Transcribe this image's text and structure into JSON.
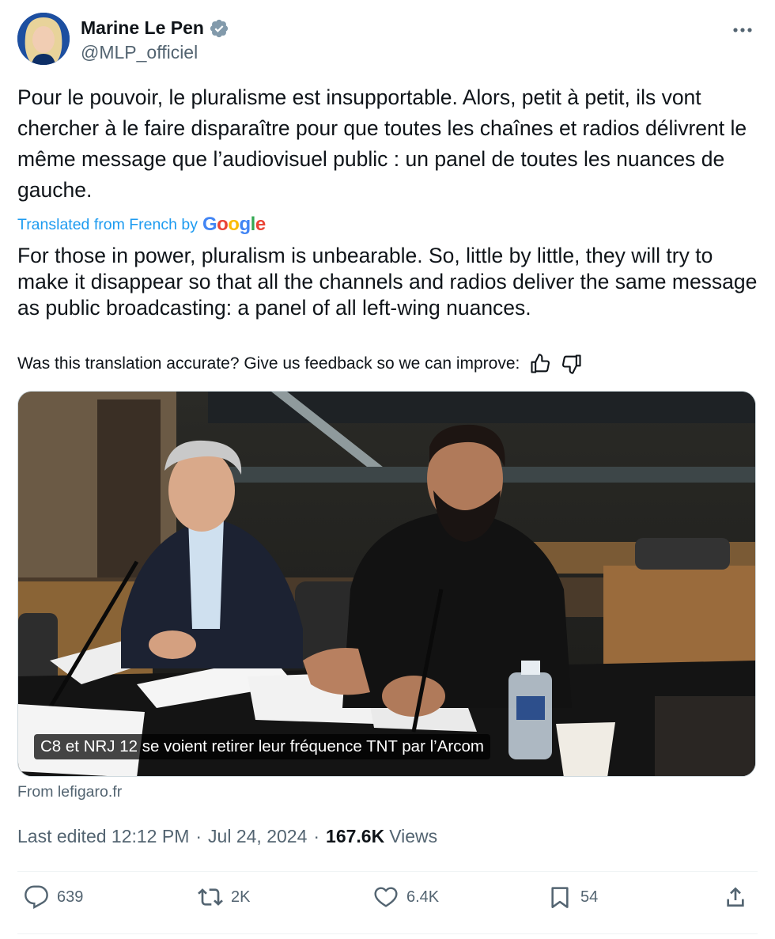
{
  "author": {
    "name": "Marine Le Pen",
    "handle": "@MLP_officiel",
    "verified": true,
    "avatar_icon": "avatar"
  },
  "tweet": {
    "text": "Pour le pouvoir, le pluralisme est insupportable. Alors, petit à petit, ils vont chercher à le faire disparaître pour que toutes les chaînes et radios délivrent le même message que l’audiovisuel public : un panel de toutes les nuances de gauche.",
    "translated_label": "Translated from French by",
    "translator_name": "Google",
    "translation": "For those in power, pluralism is unbearable. So, little by little, they will try to make it disappear so that all the channels and radios deliver the same message as public broadcasting: a panel of all left-wing nuances.",
    "feedback_prompt": "Was this translation accurate? Give us feedback so we can improve:"
  },
  "media": {
    "caption": "C8 et NRJ 12 se voient retirer leur fréquence TNT par l’Arcom",
    "source": "From lefigaro.fr"
  },
  "meta": {
    "edited": "Last edited 12:12 PM",
    "date": "Jul 24, 2024",
    "views_count": "167.6K",
    "views_label": "Views"
  },
  "actions": {
    "replies": "639",
    "reposts": "2K",
    "likes": "6.4K",
    "bookmarks": "54"
  },
  "colors": {
    "link": "#1d9bf0",
    "secondary_text": "#536471",
    "primary_text": "#0f1419"
  }
}
